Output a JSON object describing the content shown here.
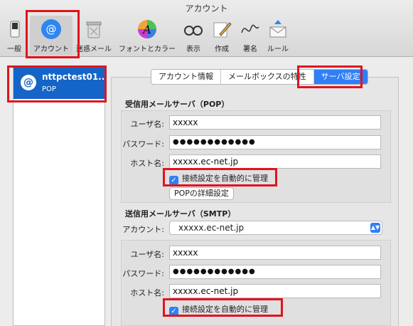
{
  "window": {
    "title": "アカウント"
  },
  "toolbar": {
    "items": [
      {
        "label": "一般",
        "icon": "switch-icon"
      },
      {
        "label": "アカウント",
        "icon": "at-icon",
        "selected": true
      },
      {
        "label": "迷惑メール",
        "icon": "trash-icon"
      },
      {
        "label": "フォントとカラー",
        "icon": "font-color-icon"
      },
      {
        "label": "表示",
        "icon": "glasses-icon"
      },
      {
        "label": "作成",
        "icon": "pencil-icon"
      },
      {
        "label": "署名",
        "icon": "signature-icon"
      },
      {
        "label": "ルール",
        "icon": "rules-icon"
      }
    ]
  },
  "sidebar": {
    "account": {
      "name": "nttpctest01...",
      "type": "POP",
      "icon": "at-icon"
    }
  },
  "tabs": [
    {
      "label": "アカウント情報"
    },
    {
      "label": "メールボックスの特性"
    },
    {
      "label": "サーバ設定",
      "active": true
    }
  ],
  "incoming": {
    "title": "受信用メールサーバ（POP）",
    "username_label": "ユーザ名:",
    "username": "xxxxx",
    "password_label": "パスワード:",
    "password": "●●●●●●●●●●●●",
    "host_label": "ホスト名:",
    "host": "xxxxx.ec-net.jp",
    "auto_manage": "接続設定を自動的に管理",
    "details_button": "POPの詳細設定"
  },
  "outgoing": {
    "title": "送信用メールサーバ（SMTP）",
    "account_label": "アカウント:",
    "account": "xxxxx.ec-net.jp",
    "username_label": "ユーザ名:",
    "username": "xxxxx",
    "password_label": "パスワード:",
    "password": "●●●●●●●●●●●●",
    "host_label": "ホスト名:",
    "host": "xxxxx.ec-net.jp",
    "auto_manage": "接続設定を自動的に管理"
  },
  "colors": {
    "accent": "#2f7ff6",
    "highlight": "#e0141e",
    "selection": "#1565c8"
  }
}
